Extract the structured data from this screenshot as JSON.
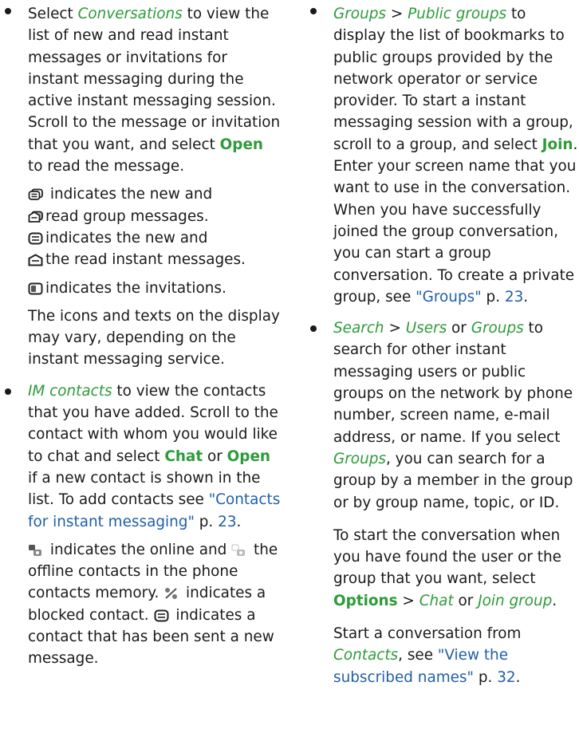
{
  "left": {
    "conv": {
      "ital": "Conversations",
      "t1": " to view the list of new and read instant messages or invitations for instant messaging during the active instant messaging session. Scroll to the message or invitation that you want, and select ",
      "b1": "Open",
      "t2": " to read the message.",
      "select_word": "Select ",
      "icons": {
        "group_new": "group-new-message-icon",
        "group_read": "group-read-message-icon",
        "im_new": "new-message-icon",
        "im_read": "read-message-icon",
        "invite": "invitation-icon"
      },
      "l1": "indicates the new and",
      "l2": "read group messages.",
      "l3": "indicates the new and",
      "l4": "the read instant messages.",
      "l5": "indicates the invitations.",
      "note": "The icons and texts on the display may vary, depending on the instant messaging service."
    },
    "imc": {
      "ital": "IM contacts",
      "t1": " to view the contacts that you have added. Scroll to the contact with whom you would like to chat and select ",
      "b1": "Chat",
      "or": " or ",
      "b2": "Open",
      "t2": " if a new contact is shown in the list. To add contacts see ",
      "link": "\"Contacts for instant messaging\"",
      "p": " p. ",
      "page": "23",
      "dot": ".",
      "d1": " indicates the online and ",
      "d2": " the offline contacts in the phone contacts memory. ",
      "d3": " indicates a blocked contact. ",
      "d4": " indicates a contact that has been sent a new message.",
      "icons": {
        "online": "online-contact-icon",
        "offline": "offline-contact-icon",
        "blocked": "blocked-contact-icon",
        "sent": "new-message-icon"
      }
    }
  },
  "right": {
    "groups": {
      "i1": "Groups",
      "sep": " > ",
      "i2": "Public groups",
      "t1": " to display the list of bookmarks to public groups provided by the network operator or service provider. To start a instant messaging session with a group, scroll to a group, and select ",
      "b1": "Join",
      "t2": ". Enter your screen name that you want to use in the conversation. When you have successfully joined the group conversation, you can start a group conversation. To create a private group, see ",
      "link": "\"Groups\"",
      "p": " p. ",
      "page": "23",
      "dot": "."
    },
    "search": {
      "i1": "Search",
      "sep": " > ",
      "i2": "Users",
      "or": " or ",
      "i3": "Groups",
      "t1": " to search for other instant messaging users or public groups on the network by phone number, screen name, e-mail address, or name. If you select ",
      "i4": "Groups",
      "t2": ", you can search for a group by a member in the group or by group name, topic, or ID.",
      "p2a": "To start the conversation when you have found the user or the group that you want, select ",
      "b1": "Options",
      "sep2": " > ",
      "i5": "Chat",
      "or2": " or ",
      "i6": "Join group",
      "dot": ".",
      "p3a": "Start a conversation from ",
      "i7": "Contacts",
      "p3b": ", see ",
      "link": "\"View the subscribed names\"",
      "p": " p. ",
      "page": "32",
      "dot2": "."
    }
  }
}
